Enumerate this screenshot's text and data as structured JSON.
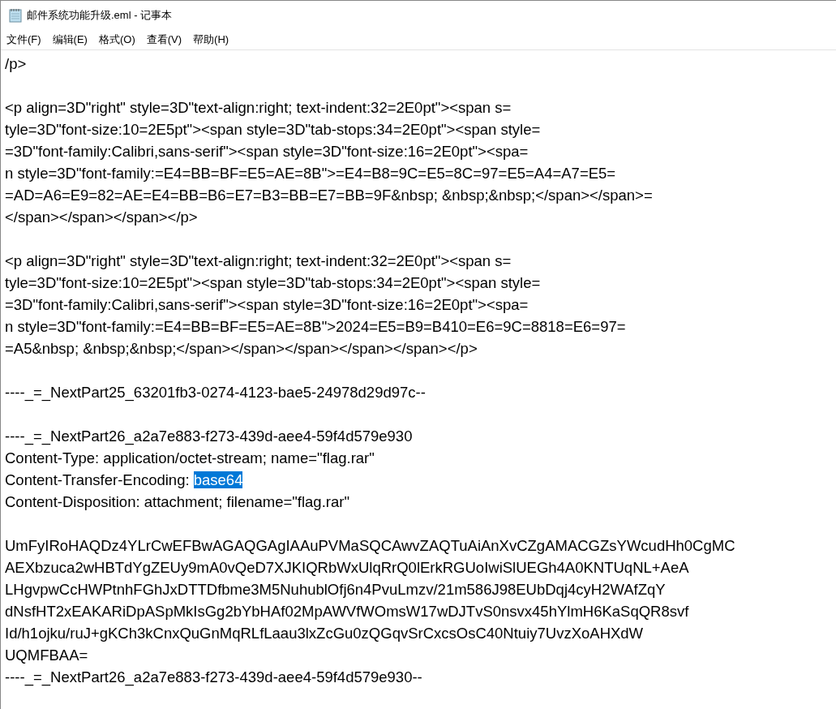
{
  "window": {
    "title": "邮件系统功能升级.eml - 记事本"
  },
  "menu": [
    "文件(F)",
    "编辑(E)",
    "格式(O)",
    "查看(V)",
    "帮助(H)"
  ],
  "editor": {
    "blocks": [
      [
        {
          "text": "/p>"
        }
      ],
      [
        {
          "text": "<p align=3D\"right\" style=3D\"text-align:right; text-indent:32=2E0pt\"><span s="
        },
        {
          "text": "tyle=3D\"font-size:10=2E5pt\"><span style=3D\"tab-stops:34=2E0pt\"><span style="
        },
        {
          "text": "=3D\"font-family:Calibri,sans-serif\"><span style=3D\"font-size:16=2E0pt\"><spa="
        },
        {
          "text": "n style=3D\"font-family:=E4=BB=BF=E5=AE=8B\">=E4=B8=9C=E5=8C=97=E5=A4=A7=E5="
        },
        {
          "text": "=AD=A6=E9=82=AE=E4=BB=B6=E7=B3=BB=E7=BB=9F&nbsp; &nbsp;&nbsp;</span></span>="
        },
        {
          "text": "</span></span></span></p>"
        }
      ],
      [
        {
          "text": "<p align=3D\"right\" style=3D\"text-align:right; text-indent:32=2E0pt\"><span s="
        },
        {
          "text": "tyle=3D\"font-size:10=2E5pt\"><span style=3D\"tab-stops:34=2E0pt\"><span style="
        },
        {
          "text": "=3D\"font-family:Calibri,sans-serif\"><span style=3D\"font-size:16=2E0pt\"><spa="
        },
        {
          "text": "n style=3D\"font-family:=E4=BB=BF=E5=AE=8B\">2024=E5=B9=B410=E6=9C=8818=E6=97="
        },
        {
          "text": "=A5&nbsp; &nbsp;&nbsp;</span></span></span></span></span></p>"
        }
      ],
      [
        {
          "text": "----_=_NextPart25_63201fb3-0274-4123-bae5-24978d29d97c--"
        }
      ],
      [
        {
          "text": "----_=_NextPart26_a2a7e883-f273-439d-aee4-59f4d579e930"
        },
        {
          "text": "Content-Type: application/octet-stream; name=\"flag.rar\""
        },
        {
          "text": "Content-Transfer-Encoding: ",
          "selection": "base64"
        },
        {
          "text": "Content-Disposition: attachment; filename=\"flag.rar\""
        }
      ],
      [
        {
          "text": "UmFyIRoHAQDz4YLrCwEFBwAGAQGAgIAAuPVMaSQCAwvZAQTuAiAnXvCZgAMACGZsYWcudHh0CgMC"
        },
        {
          "text": "AEXbzuca2wHBTdYgZEUy9mA0vQeD7XJKIQRbWxUlqRrQ0lErkRGUoIwiSlUEGh4A0KNTUqNL+AeA"
        },
        {
          "text": "LHgvpwCcHWPtnhFGhJxDTTDfbme3M5NuhublOfj6n4PvuLmzv/21m586J98EUbDqj4cyH2WAfZqY"
        },
        {
          "text": "dNsfHT2xEAKARiDpASpMkIsGg2bYbHAf02MpAWVfWOmsW17wDJTvS0nsvx45hYlmH6KaSqQR8svf"
        },
        {
          "text": "Id/h1ojku/ruJ+gKCh3kCnxQuGnMqRLfLaau3lxZcGu0zQGqvSrCxcsOsC40Ntuiy7UvzXoAHXdW"
        },
        {
          "text": "UQMFBAA="
        },
        {
          "text": "----_=_NextPart26_a2a7e883-f273-439d-aee4-59f4d579e930--"
        }
      ]
    ]
  }
}
